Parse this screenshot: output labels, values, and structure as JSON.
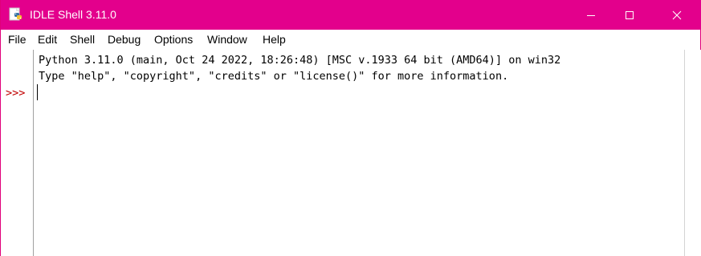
{
  "window": {
    "title": "IDLE Shell 3.11.0",
    "titlebar_color": "#e3008c",
    "controls": {
      "minimize_icon": "minimize-icon",
      "maximize_icon": "maximize-icon",
      "close_icon": "close-icon"
    }
  },
  "menubar": {
    "items": [
      "File",
      "Edit",
      "Shell",
      "Debug",
      "Options",
      "Window",
      "Help"
    ]
  },
  "shell": {
    "output_lines": [
      "Python 3.11.0 (main, Oct 24 2022, 18:26:48) [MSC v.1933 64 bit (AMD64)] on win32",
      "Type \"help\", \"copyright\", \"credits\" or \"license()\" for more information."
    ],
    "prompt": ">>>",
    "prompt_color": "#c00000"
  }
}
